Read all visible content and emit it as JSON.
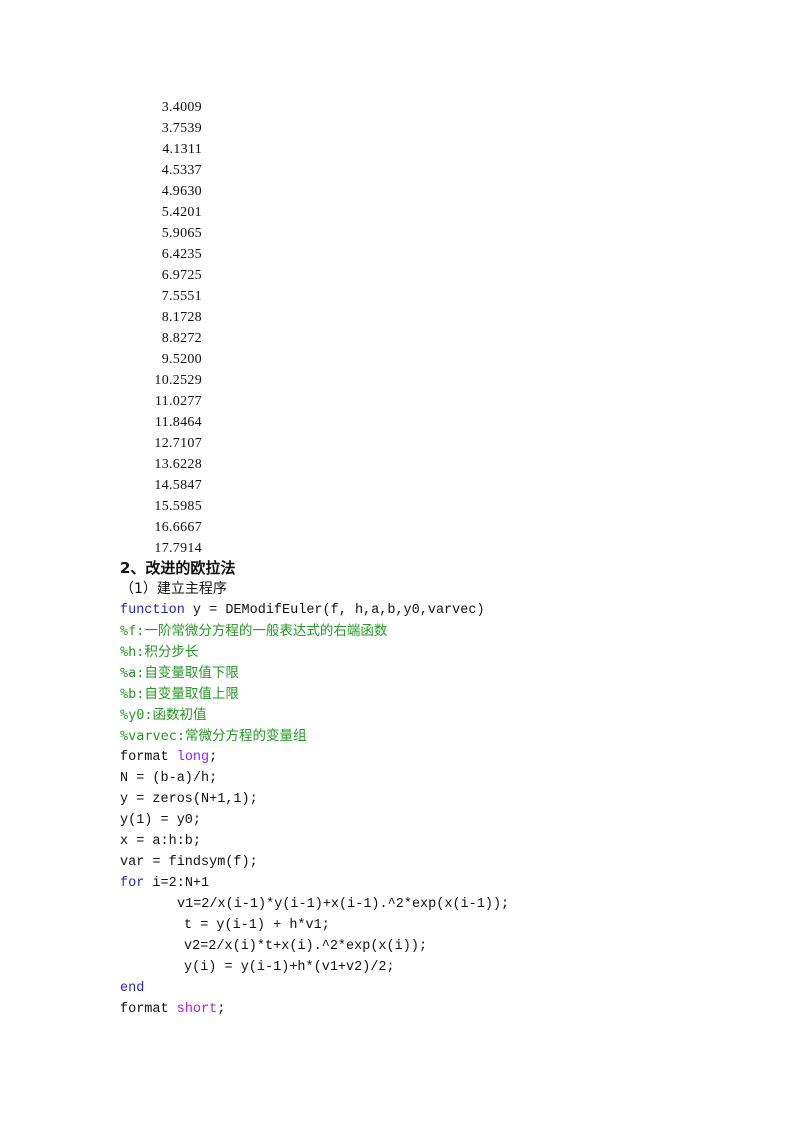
{
  "results": {
    "values": [
      "3.4009",
      "3.7539",
      "4.1311",
      "4.5337",
      "4.9630",
      "5.4201",
      "5.9065",
      "6.4235",
      "6.9725",
      "7.5551",
      "8.1728",
      "8.8272",
      "9.5200",
      "10.2529",
      "11.0277",
      "11.8464",
      "12.7107",
      "13.6228",
      "14.5847",
      "15.5985",
      "16.6667",
      "17.7914"
    ]
  },
  "section": {
    "heading": "2、改进的欧拉法",
    "subheading": "（1）建立主程序"
  },
  "code": {
    "function_keyword": "function",
    "function_signature": " y = DEModifEuler(f, h,a,b,y0,varvec)",
    "comments": [
      "%f:一阶常微分方程的一般表达式的右端函数",
      "%h:积分步长",
      "%a:自变量取值下限",
      "%b:自变量取值上限",
      "%y0:函数初值",
      "%varvec:常微分方程的变量组"
    ],
    "format_long_cmd": "format ",
    "format_long_arg": "long",
    "format_long_end": ";",
    "statements": [
      "N = (b-a)/h;",
      "y = zeros(N+1,1);",
      "y(1) = y0;",
      "x = a:h:b;",
      "var = findsym(f);"
    ],
    "for_keyword": "for",
    "for_range": " i=2:N+1",
    "loop_body": [
      "v1=2/x(i-1)*y(i-1)+x(i-1).^2*exp(x(i-1));",
      "t = y(i-1) + h*v1;",
      "v2=2/x(i)*t+x(i).^2*exp(x(i));",
      "y(i) = y(i-1)+h*(v1+v2)/2;"
    ],
    "end_keyword": "end",
    "format_short_cmd": "format ",
    "format_short_arg": "short",
    "format_short_end": ";"
  },
  "colors": {
    "keyword": "#2424c8",
    "comment": "#229922",
    "string": "#a020f0",
    "text": "#111111"
  }
}
